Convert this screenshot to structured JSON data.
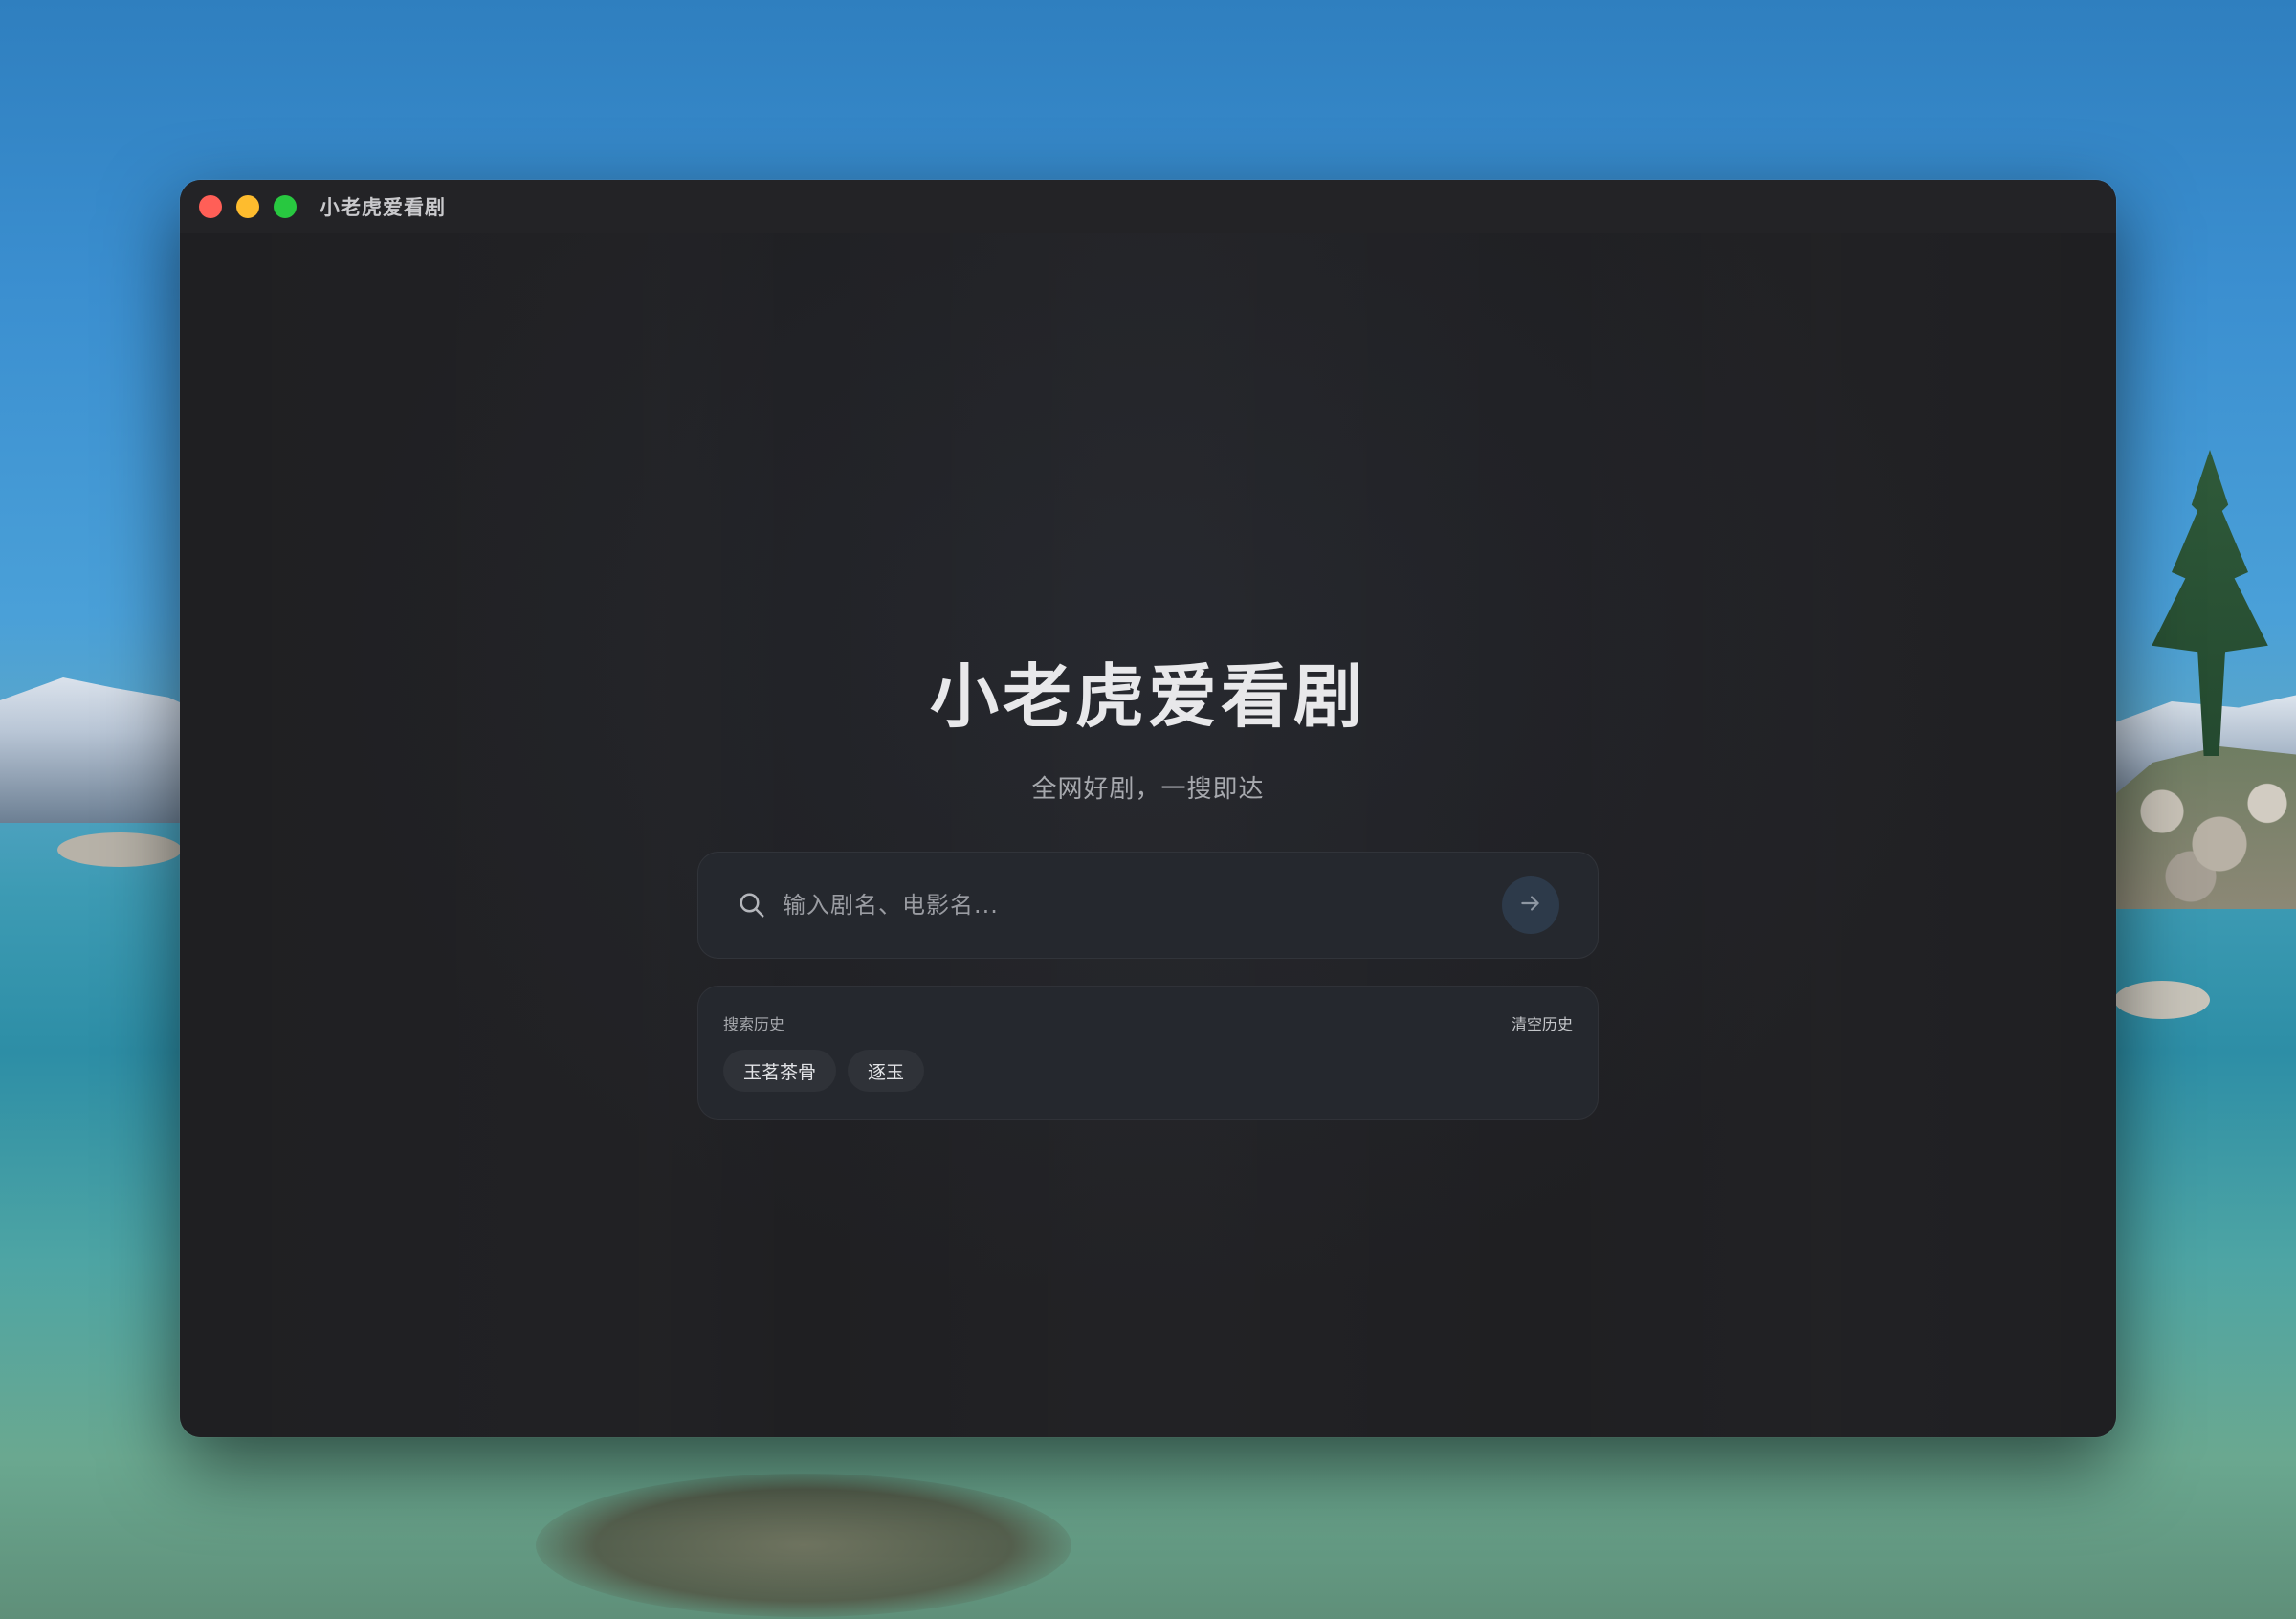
{
  "window": {
    "title": "小老虎爱看剧"
  },
  "hero": {
    "title": "小老虎爱看剧",
    "subtitle": "全网好剧，一搜即达"
  },
  "search": {
    "placeholder": "输入剧名、电影名...",
    "value": "",
    "search_icon": "search-icon",
    "submit_icon": "arrow-right-icon"
  },
  "history": {
    "label": "搜索历史",
    "clear_label": "清空历史",
    "items": [
      "玉茗茶骨",
      "逐玉"
    ]
  },
  "colors": {
    "window_bg": "#1f1f22",
    "panel_bg": "#25282e",
    "tag_bg": "#2f3238",
    "submit_bg": "#2d3a4a",
    "close": "#ff5f57",
    "minimize": "#febc2e",
    "zoom": "#28c840"
  }
}
